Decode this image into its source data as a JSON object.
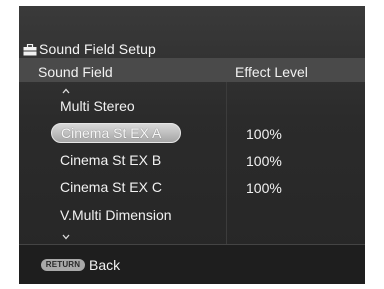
{
  "window": {
    "title": "Sound Field Setup",
    "title_icon": "toolbox-icon"
  },
  "table": {
    "col_sound_field": "Sound Field",
    "col_effect_level": "Effect Level",
    "scroll_up_icon": "chevron-up-icon",
    "scroll_down_icon": "chevron-down-icon",
    "rows": [
      {
        "name": "Multi Stereo",
        "level": ""
      },
      {
        "name": "Cinema St EX A",
        "level": "100%",
        "selected": true
      },
      {
        "name": "Cinema St EX B",
        "level": "100%"
      },
      {
        "name": "Cinema St EX C",
        "level": "100%"
      },
      {
        "name": "V.Multi Dimension",
        "level": ""
      }
    ]
  },
  "footer": {
    "return_button_label": "RETURN",
    "back_label": "Back"
  },
  "colors": {
    "panel_background": "#2b2b2b",
    "header_band": "#4a4a4a",
    "selection_pill": "#bdbdbd",
    "footer_background": "#1e1e1e"
  }
}
